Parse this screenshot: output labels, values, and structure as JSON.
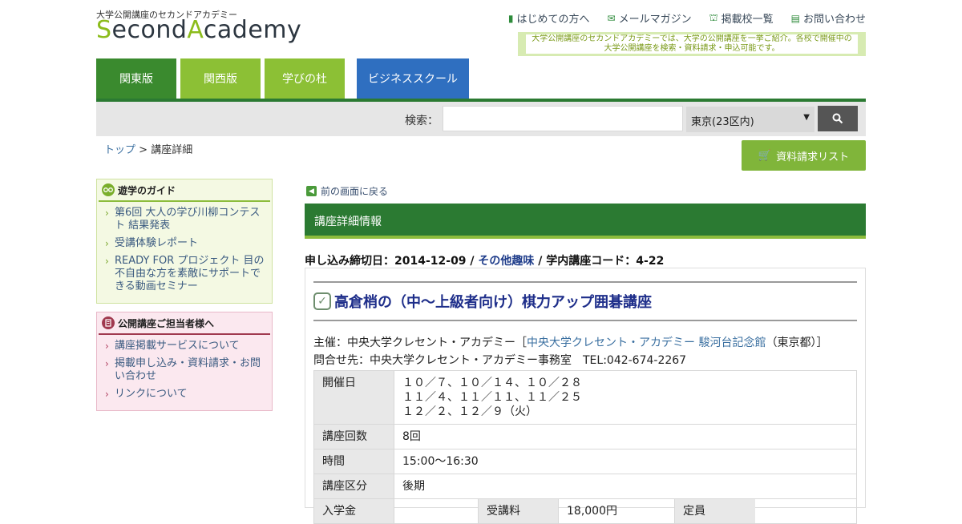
{
  "header": {
    "tagline": "大学公開講座のセカンドアカデミー",
    "logo": {
      "part1": "S",
      "part2": "econd",
      "part3": "A",
      "part4": "cademy"
    },
    "topnav": [
      {
        "label": "はじめての方へ",
        "icon": "book-icon"
      },
      {
        "label": "メールマガジン",
        "icon": "mail-icon"
      },
      {
        "label": "掲載校一覧",
        "icon": "building-icon"
      },
      {
        "label": "お問い合わせ",
        "icon": "document-icon"
      }
    ],
    "notice": "大学公開講座のセカンドアカデミーでは、大学の公開講座を一挙ご紹介。各校で開催中の大学公開講座を検索・資料請求・申込可能です。"
  },
  "tabs": [
    {
      "label": "関東版",
      "color": "#3a8a2e"
    },
    {
      "label": "関西版",
      "color": "#8cc035"
    },
    {
      "label": "学びの杜",
      "color": "#8cc035"
    },
    {
      "label": "ビジネススクール",
      "color": "#2f6fc0"
    }
  ],
  "search": {
    "label": "検索：",
    "value": "",
    "region": "東京(23区内)"
  },
  "breadcrumb": {
    "top": "トップ",
    "sep": " > ",
    "current": "講座詳細"
  },
  "request_list": "資料請求リスト",
  "sidebar": {
    "guide": {
      "title": "遊学のガイド",
      "items": [
        "第6回 大人の学び川柳コンテスト 結果発表",
        "受講体験レポート",
        "READY FOR プロジェクト 目の不自由な方を素敵にサポートできる動画セミナー"
      ]
    },
    "staff": {
      "title": "公開講座ご担当者様へ",
      "items": [
        "講座掲載サービスについて",
        "掲載申し込み・資料請求・お問い合わせ",
        "リンクについて"
      ]
    }
  },
  "main": {
    "back": "前の画面に戻る",
    "section_title": "講座詳細情報",
    "meta": {
      "deadline": "申し込み締切日：2014-12-09 / ",
      "category": "その他趣味",
      "code": " / 学内講座コード：4-22"
    },
    "course": {
      "title": "高倉梢の（中～上級者向け）棋力アップ囲碁講座",
      "host_prefix": "主催：中央大学クレセント・アカデミー［",
      "host_link": "中央大学クレセント・アカデミー 駿河台記念館",
      "host_suffix": "（東京都）］",
      "contact": "問合せ先：中央大学クレセント・アカデミー事務室　TEL:042-674-2267"
    },
    "table": [
      {
        "label": "開催日",
        "value": [
          "１０／７、１０／１４、１０／２８",
          "１１／４、１１／１１、１１／２５",
          "１２／２、１２／９（火）"
        ]
      },
      {
        "label": "講座回数",
        "value": [
          "8回"
        ]
      },
      {
        "label": "時間",
        "value": [
          "15:00～16:30"
        ]
      },
      {
        "label": "講座区分",
        "value": [
          "後期"
        ]
      }
    ],
    "partial_row": {
      "a": "入学金",
      "b": "受講料",
      "c": "18,000円",
      "d": "定員"
    }
  }
}
